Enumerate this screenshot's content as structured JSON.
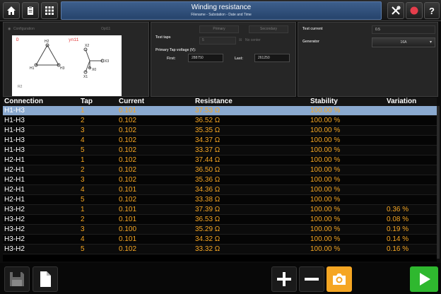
{
  "header": {
    "title": "Winding resistance",
    "subtitle": "Filename - Substation - Date and Time",
    "icons": {
      "home": "home-icon",
      "clipboard": "clipboard-icon",
      "grid": "grid-icon",
      "tools": "tools-icon",
      "record": "record-icon",
      "help": "help-icon"
    },
    "help_label": "?"
  },
  "config": {
    "tab_configuration": "Configuration",
    "tab_opt": "Opt11",
    "label_d": "D",
    "label_yn": "yn11",
    "nodes_hv": [
      "H2",
      "H1",
      "H3"
    ],
    "nodes_lv": [
      "X2",
      "X3",
      "X0",
      "X1"
    ],
    "bottom_label": "R2"
  },
  "taps": {
    "primary_label": "Primary",
    "secondary_label": "Secondary",
    "test_taps_label": "Test taps",
    "test_taps_value": "5",
    "neutral_label": "No center",
    "voltage_label": "Primary Tap voltage (V):",
    "first_label": "First:",
    "first_value": "288750",
    "last_label": "Last:",
    "last_value": "261250"
  },
  "settings": {
    "test_current_label": "Test current",
    "test_current_value": "0.5",
    "generator_label": "Generator",
    "generator_value": "16A"
  },
  "table": {
    "headers": {
      "connection": "Connection",
      "tap": "Tap",
      "current": "Current",
      "resistance": "Resistance",
      "stability": "Stability",
      "variation": "Variation"
    },
    "rows": [
      {
        "connection": "H1-H3",
        "tap": "1",
        "current": "0.101",
        "resistance": "37.53 Ω",
        "stability": "100.00 %",
        "variation": ""
      },
      {
        "connection": "H1-H3",
        "tap": "2",
        "current": "0.102",
        "resistance": "36.52 Ω",
        "stability": "100.00 %",
        "variation": ""
      },
      {
        "connection": "H1-H3",
        "tap": "3",
        "current": "0.102",
        "resistance": "35.35 Ω",
        "stability": "100.00 %",
        "variation": ""
      },
      {
        "connection": "H1-H3",
        "tap": "4",
        "current": "0.102",
        "resistance": "34.37 Ω",
        "stability": "100.00 %",
        "variation": ""
      },
      {
        "connection": "H1-H3",
        "tap": "5",
        "current": "0.102",
        "resistance": "33.37 Ω",
        "stability": "100.00 %",
        "variation": ""
      },
      {
        "connection": "H2-H1",
        "tap": "1",
        "current": "0.102",
        "resistance": "37.44 Ω",
        "stability": "100.00 %",
        "variation": ""
      },
      {
        "connection": "H2-H1",
        "tap": "2",
        "current": "0.102",
        "resistance": "36.50 Ω",
        "stability": "100.00 %",
        "variation": ""
      },
      {
        "connection": "H2-H1",
        "tap": "3",
        "current": "0.102",
        "resistance": "35.36 Ω",
        "stability": "100.00 %",
        "variation": ""
      },
      {
        "connection": "H2-H1",
        "tap": "4",
        "current": "0.101",
        "resistance": "34.36 Ω",
        "stability": "100.00 %",
        "variation": ""
      },
      {
        "connection": "H2-H1",
        "tap": "5",
        "current": "0.102",
        "resistance": "33.38 Ω",
        "stability": "100.00 %",
        "variation": ""
      },
      {
        "connection": "H3-H2",
        "tap": "1",
        "current": "0.101",
        "resistance": "37.39 Ω",
        "stability": "100.00 %",
        "variation": "0.36 %"
      },
      {
        "connection": "H3-H2",
        "tap": "2",
        "current": "0.101",
        "resistance": "36.53 Ω",
        "stability": "100.00 %",
        "variation": "0.08 %"
      },
      {
        "connection": "H3-H2",
        "tap": "3",
        "current": "0.100",
        "resistance": "35.29 Ω",
        "stability": "100.00 %",
        "variation": "0.19 %"
      },
      {
        "connection": "H3-H2",
        "tap": "4",
        "current": "0.101",
        "resistance": "34.32 Ω",
        "stability": "100.00 %",
        "variation": "0.14 %"
      },
      {
        "connection": "H3-H2",
        "tap": "5",
        "current": "0.102",
        "resistance": "33.32 Ω",
        "stability": "100.00 %",
        "variation": "0.16 %"
      }
    ],
    "selected_row": 0
  },
  "footer": {
    "icons": {
      "save": "save-icon",
      "document": "document-icon",
      "add": "plus-icon",
      "remove": "minus-icon",
      "camera": "camera-icon",
      "play": "play-icon"
    }
  },
  "colors": {
    "value": "#f5a623",
    "selected_row": "#8aa9cf",
    "title_bar": "#3d5f8c",
    "camera_button": "#f5a623",
    "play_button": "#2fb82f"
  }
}
